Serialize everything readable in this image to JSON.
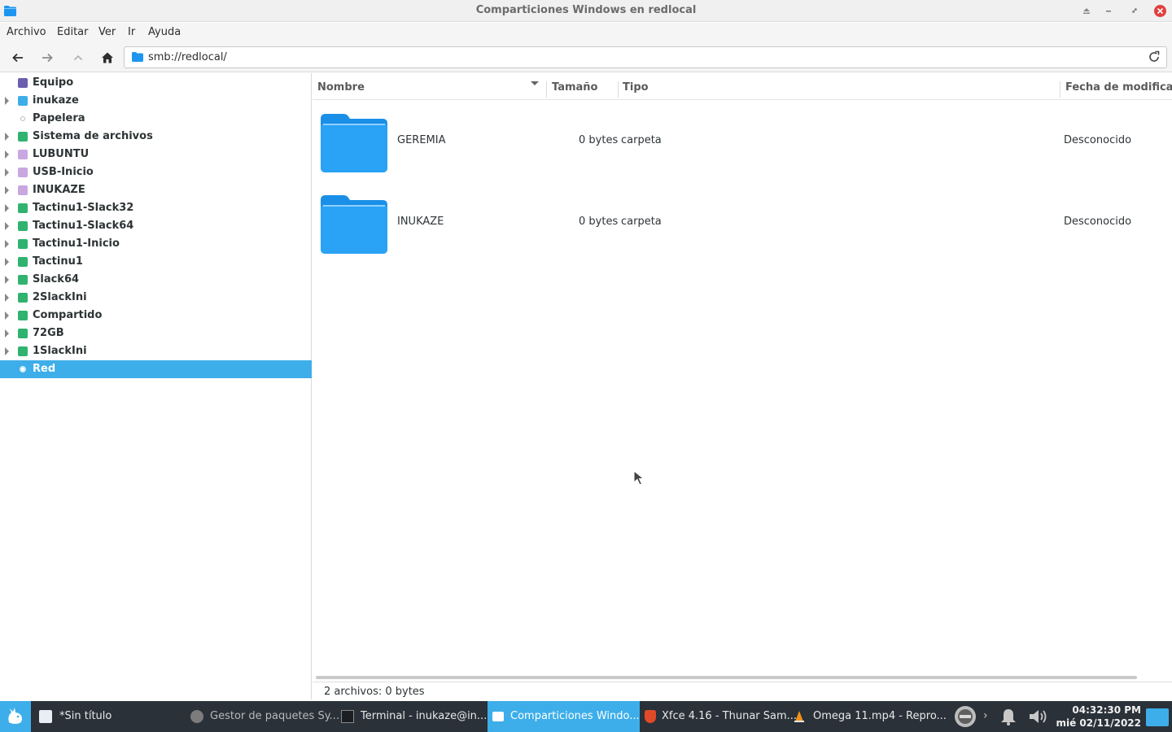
{
  "window": {
    "title": "Comparticiones Windows en redlocal"
  },
  "menu": {
    "archivo": "Archivo",
    "editar": "Editar",
    "ver": "Ver",
    "ir": "Ir",
    "ayuda": "Ayuda"
  },
  "location": {
    "path": "smb://redlocal/"
  },
  "sidebar": {
    "items": [
      {
        "label": "Equipo"
      },
      {
        "label": "inukaze"
      },
      {
        "label": "Papelera"
      },
      {
        "label": "Sistema de archivos"
      },
      {
        "label": "LUBUNTU"
      },
      {
        "label": "USB-Inicio"
      },
      {
        "label": "INUKAZE"
      },
      {
        "label": "Tactinu1-Slack32"
      },
      {
        "label": "Tactinu1-Slack64"
      },
      {
        "label": "Tactinu1-Inicio"
      },
      {
        "label": "Tactinu1"
      },
      {
        "label": "Slack64"
      },
      {
        "label": "2SlackIni"
      },
      {
        "label": "Compartido"
      },
      {
        "label": "72GB"
      },
      {
        "label": "1SlackIni"
      },
      {
        "label": "Red"
      }
    ]
  },
  "columns": {
    "name": "Nombre",
    "size": "Tamaño",
    "type": "Tipo",
    "modified": "Fecha de modificació"
  },
  "files": [
    {
      "name": "GEREMIA",
      "size": "0 bytes",
      "type": "carpeta",
      "modified": "Desconocido"
    },
    {
      "name": "INUKAZE",
      "size": "0 bytes",
      "type": "carpeta",
      "modified": "Desconocido"
    }
  ],
  "status": {
    "text": "2 archivos: 0 bytes"
  },
  "taskbar": {
    "tasks": [
      {
        "label": "*Sin título"
      },
      {
        "label": "Gestor de paquetes Sy..."
      },
      {
        "label": "Terminal - inukaze@in..."
      },
      {
        "label": "Comparticiones Windo..."
      },
      {
        "label": "Xfce 4.16 - Thunar Sam..."
      },
      {
        "label": "Omega 11.mp4 - Repro..."
      }
    ],
    "clock_time": "04:32:30 PM",
    "clock_date": "mié 02/11/2022"
  },
  "colors": {
    "accent": "#3daee9",
    "folder": "#1e96f0",
    "taskbar": "#2a3138",
    "close": "#e0403e"
  }
}
